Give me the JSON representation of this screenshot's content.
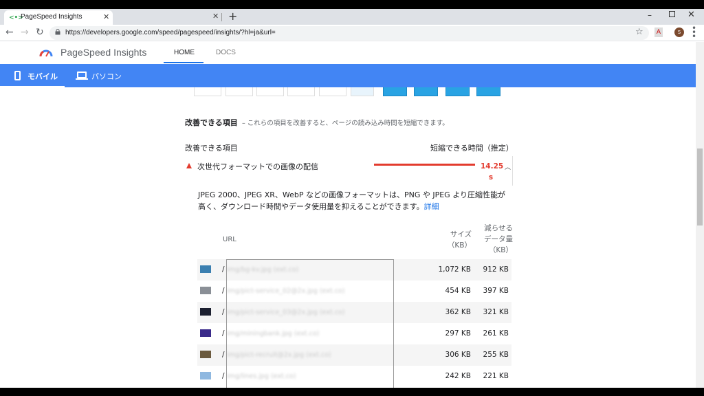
{
  "browser": {
    "tab_title": "PageSpeed Insights",
    "tab_close": "✕",
    "tab2_close": "✕",
    "new_tab": "+",
    "url": "https://developers.google.com/speed/pagespeed/insights/?hl=ja&url=",
    "win_min": "–",
    "win_close": "✕",
    "avatar_initial": "S",
    "pdf_ext": "A"
  },
  "header": {
    "brand": "PageSpeed Insights",
    "tabs": [
      {
        "label": "HOME",
        "active": true
      },
      {
        "label": "DOCS",
        "active": false
      }
    ]
  },
  "device_bar": {
    "mobile": "モバイル",
    "desktop": "パソコン",
    "active": "mobile"
  },
  "opportunities": {
    "section_title": "改善できる項目",
    "section_desc": "– これらの項目を改善すると、ページの読み込み時間を短縮できます。",
    "col_left": "改善できる項目",
    "col_right": "短縮できる時間（推定）",
    "audit": {
      "title": "次世代フォーマットでの画像の配信",
      "value": "14.25 s",
      "description": "JPEG 2000、JPEG XR、WebP などの画像フォーマットは、PNG や JPEG より圧縮性能が高く、ダウンロード時間やデータ使用量を抑えることができます。",
      "learn_more": "詳細"
    },
    "table": {
      "col_url": "URL",
      "col_size": "サイズ（KB）",
      "col_saving": "減らせるデータ量（KB）",
      "rows": [
        {
          "slash": "/",
          "path": "img/bg-kv.jpg   (ext.co)",
          "size": "1,072 KB",
          "saving": "912 KB",
          "thumb_color": "#3b7fb0"
        },
        {
          "slash": "/",
          "path": "img/pict-service_02@2x.jpg   (ext.co)",
          "size": "454 KB",
          "saving": "397 KB",
          "thumb_color": "#8a8f96"
        },
        {
          "slash": "/",
          "path": "img/pict-service_03@2x.jpg   (ext.co)",
          "size": "362 KB",
          "saving": "321 KB",
          "thumb_color": "#1c2030"
        },
        {
          "slash": "/",
          "path": "img/miningbank.jpg   (ext.co)",
          "size": "297 KB",
          "saving": "261 KB",
          "thumb_color": "#3a2a8a"
        },
        {
          "slash": "/",
          "path": "img/pict-recruit@2x.jpg   (ext.co)",
          "size": "306 KB",
          "saving": "255 KB",
          "thumb_color": "#6b5a3e"
        },
        {
          "slash": "/",
          "path": "img/lines.jpg   (ext.co)",
          "size": "242 KB",
          "saving": "221 KB",
          "thumb_color": "#8fb8e0"
        }
      ]
    }
  },
  "colors": {
    "accent_blue": "#4285f4",
    "fail_red": "#e33b2e",
    "link_blue": "#1a73e8"
  }
}
